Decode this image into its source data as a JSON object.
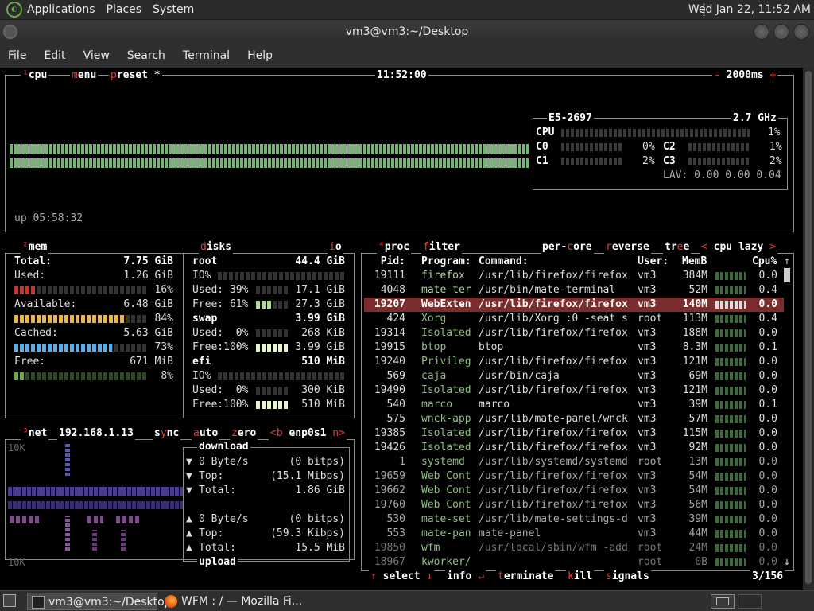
{
  "top_panel": {
    "menus": [
      "Applications",
      "Places",
      "System"
    ],
    "clock": "Wed Jan 22, 11:52 AM"
  },
  "window": {
    "title": "vm3@vm3:~/Desktop",
    "menu": [
      "File",
      "Edit",
      "View",
      "Search",
      "Terminal",
      "Help"
    ]
  },
  "cpu": {
    "tabs": {
      "cpu": "cpu",
      "menu": "menu",
      "preset": "preset *"
    },
    "clock": "11:52:00",
    "interval": "2000ms",
    "uptime": "up 05:58:32",
    "model": "E5-2697",
    "freq": "2.7 GHz",
    "total_label": "CPU",
    "total_pct": "1%",
    "cores": [
      {
        "name": "C0",
        "pct": "0%"
      },
      {
        "name": "C1",
        "pct": "2%"
      },
      {
        "name": "C2",
        "pct": "1%"
      },
      {
        "name": "C3",
        "pct": "2%"
      }
    ],
    "load": "LAV: 0.00 0.00 0.04"
  },
  "mem": {
    "title": "mem",
    "total_label": "Total:",
    "total": "7.75 GiB",
    "used_label": "Used:",
    "used": "1.26 GiB",
    "used_pct": "16%",
    "used_frac": 0.16,
    "avail_label": "Available:",
    "avail": "6.48 GiB",
    "avail_pct": "84%",
    "avail_frac": 0.84,
    "cached_label": "Cached:",
    "cached": "5.63 GiB",
    "cached_pct": "73%",
    "cached_frac": 0.73,
    "free_label": "Free:",
    "free": "671 MiB",
    "free_pct": "8%",
    "free_frac": 0.08
  },
  "disks": {
    "title": "disks",
    "io_tab": "io",
    "root": {
      "name": "root",
      "size": "44.4 GiB",
      "io": "IO%",
      "used": "Used: 39%",
      "used_val": "17.1 GiB",
      "free": "Free: 61%",
      "free_val": "27.3 GiB"
    },
    "swap": {
      "name": "swap",
      "size": "3.99 GiB",
      "used": "Used:  0%",
      "used_val": "268 KiB",
      "free": "Free:100%",
      "free_val": "3.99 GiB"
    },
    "efi": {
      "name": "efi",
      "size": "510 MiB",
      "io": "IO%",
      "used": "Used:  0%",
      "used_val": "300 KiB",
      "free": "Free:100%",
      "free_val": "510 MiB"
    }
  },
  "net": {
    "title": "net",
    "ip": "192.168.1.13",
    "sync": "sync",
    "auto": "auto",
    "zero": "zero",
    "iface_prev": "<b",
    "iface": "enp0s1",
    "iface_next": "n>",
    "scale_top": "10K",
    "scale_bottom": "10K",
    "download": {
      "label": "download",
      "rate": "0 Byte/s",
      "bitps": "(0 bitps)",
      "top_label": "Top:",
      "top": "(15.1 Mibps)",
      "total_label": "Total:",
      "total": "1.86 GiB"
    },
    "upload": {
      "label": "upload",
      "rate": "0 Byte/s",
      "bitps": "(0 bitps)",
      "top_label": "Top:",
      "top": "(59.3 Kibps)",
      "total_label": "Total:",
      "total": "15.5 MiB"
    }
  },
  "proc": {
    "tabs": {
      "proc": "proc",
      "filter": "filter",
      "per_core": "per-core",
      "reverse": "reverse",
      "tree": "tree",
      "sort_prev": "<",
      "sort": "cpu lazy",
      "sort_next": ">"
    },
    "headers": {
      "pid": "Pid:",
      "program": "Program:",
      "command": "Command:",
      "user": "User:",
      "mem": "MemB",
      "cpu": "Cpu%"
    },
    "rows": [
      {
        "pid": "19111",
        "program": "firefox",
        "command": "/usr/lib/firefox/firefox",
        "user": "vm3",
        "mem": "384M",
        "cpu": "0.0"
      },
      {
        "pid": "4048",
        "program": "mate-ter",
        "command": "/usr/bin/mate-terminal",
        "user": "vm3",
        "mem": "52M",
        "cpu": "0.4"
      },
      {
        "pid": "19207",
        "program": "WebExten",
        "command": "/usr/lib/firefox/firefox",
        "user": "vm3",
        "mem": "140M",
        "cpu": "0.0"
      },
      {
        "pid": "424",
        "program": "Xorg",
        "command": "/usr/lib/Xorg :0 -seat s",
        "user": "root",
        "mem": "113M",
        "cpu": "0.4"
      },
      {
        "pid": "19314",
        "program": "Isolated",
        "command": "/usr/lib/firefox/firefox",
        "user": "vm3",
        "mem": "188M",
        "cpu": "0.0"
      },
      {
        "pid": "19915",
        "program": "btop",
        "command": "btop",
        "user": "vm3",
        "mem": "8.3M",
        "cpu": "0.1"
      },
      {
        "pid": "19240",
        "program": "Privileg",
        "command": "/usr/lib/firefox/firefox",
        "user": "vm3",
        "mem": "121M",
        "cpu": "0.0"
      },
      {
        "pid": "569",
        "program": "caja",
        "command": "/usr/bin/caja",
        "user": "vm3",
        "mem": "69M",
        "cpu": "0.0"
      },
      {
        "pid": "19490",
        "program": "Isolated",
        "command": "/usr/lib/firefox/firefox",
        "user": "vm3",
        "mem": "121M",
        "cpu": "0.0"
      },
      {
        "pid": "540",
        "program": "marco",
        "command": "marco",
        "user": "vm3",
        "mem": "39M",
        "cpu": "0.1"
      },
      {
        "pid": "575",
        "program": "wnck-app",
        "command": "/usr/lib/mate-panel/wnck",
        "user": "vm3",
        "mem": "57M",
        "cpu": "0.0"
      },
      {
        "pid": "19385",
        "program": "Isolated",
        "command": "/usr/lib/firefox/firefox",
        "user": "vm3",
        "mem": "115M",
        "cpu": "0.0"
      },
      {
        "pid": "19426",
        "program": "Isolated",
        "command": "/usr/lib/firefox/firefox",
        "user": "vm3",
        "mem": "92M",
        "cpu": "0.0"
      },
      {
        "pid": "1",
        "program": "systemd",
        "command": "/usr/lib/systemd/systemd",
        "user": "root",
        "mem": "13M",
        "cpu": "0.0"
      },
      {
        "pid": "19659",
        "program": "Web Cont",
        "command": "/usr/lib/firefox/firefox",
        "user": "vm3",
        "mem": "54M",
        "cpu": "0.0"
      },
      {
        "pid": "19662",
        "program": "Web Cont",
        "command": "/usr/lib/firefox/firefox",
        "user": "vm3",
        "mem": "54M",
        "cpu": "0.0"
      },
      {
        "pid": "19760",
        "program": "Web Cont",
        "command": "/usr/lib/firefox/firefox",
        "user": "vm3",
        "mem": "56M",
        "cpu": "0.0"
      },
      {
        "pid": "530",
        "program": "mate-set",
        "command": "/usr/lib/mate-settings-d",
        "user": "vm3",
        "mem": "39M",
        "cpu": "0.0"
      },
      {
        "pid": "553",
        "program": "mate-pan",
        "command": "mate-panel",
        "user": "vm3",
        "mem": "44M",
        "cpu": "0.0"
      },
      {
        "pid": "19850",
        "program": "wfm",
        "command": "/usr/local/sbin/wfm -add",
        "user": "root",
        "mem": "24M",
        "cpu": "0.0"
      },
      {
        "pid": "18967",
        "program": "kworker/",
        "command": "",
        "user": "root",
        "mem": "0B",
        "cpu": "0.0"
      }
    ],
    "selected_index": 2,
    "footer": {
      "select": "select",
      "info": "info",
      "terminate": "terminate",
      "kill": "kill",
      "signals": "signals",
      "count": "3/156"
    }
  },
  "taskbar": {
    "items": [
      "vm3@vm3:~/Desktop",
      "WFM : / — Mozilla Fi..."
    ]
  },
  "colors": {
    "accent": "#e23b3b",
    "selected_row": "#7b2d2d",
    "mem_used": "#c0392b",
    "mem_avail": "#e6b450",
    "mem_cached": "#5dade2",
    "mem_free": "#6aa84f"
  }
}
